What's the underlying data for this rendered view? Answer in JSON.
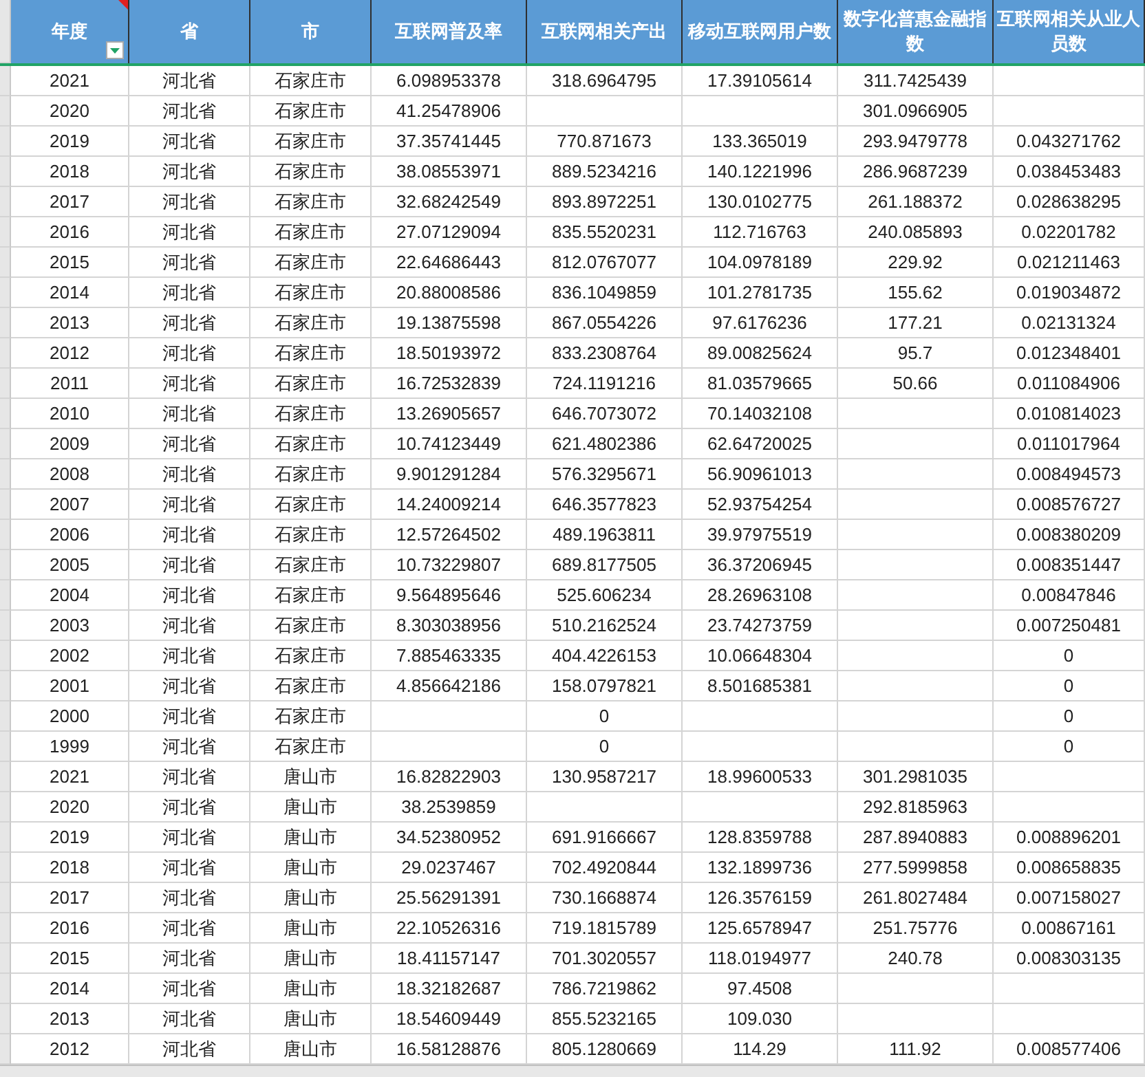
{
  "table": {
    "columns": [
      {
        "label": "年度",
        "filter": true,
        "comment": true
      },
      {
        "label": "省",
        "filter": false,
        "comment": false
      },
      {
        "label": "市",
        "filter": false,
        "comment": false
      },
      {
        "label": "互联网普及率",
        "filter": false,
        "comment": false
      },
      {
        "label": "互联网相关产出",
        "filter": false,
        "comment": false
      },
      {
        "label": "移动互联网用户数",
        "filter": false,
        "comment": false
      },
      {
        "label": "数字化普惠金融指数",
        "filter": false,
        "comment": false
      },
      {
        "label": "互联网相关从业人员数",
        "filter": false,
        "comment": false
      }
    ],
    "rows": [
      [
        "2021",
        "河北省",
        "石家庄市",
        "6.098953378",
        "318.6964795",
        "17.39105614",
        "311.7425439",
        null
      ],
      [
        "2020",
        "河北省",
        "石家庄市",
        "41.25478906",
        null,
        null,
        "301.0966905",
        null
      ],
      [
        "2019",
        "河北省",
        "石家庄市",
        "37.35741445",
        "770.871673",
        "133.365019",
        "293.9479778",
        "0.043271762"
      ],
      [
        "2018",
        "河北省",
        "石家庄市",
        "38.08553971",
        "889.5234216",
        "140.1221996",
        "286.9687239",
        "0.038453483"
      ],
      [
        "2017",
        "河北省",
        "石家庄市",
        "32.68242549",
        "893.8972251",
        "130.0102775",
        "261.188372",
        "0.028638295"
      ],
      [
        "2016",
        "河北省",
        "石家庄市",
        "27.07129094",
        "835.5520231",
        "112.716763",
        "240.085893",
        "0.02201782"
      ],
      [
        "2015",
        "河北省",
        "石家庄市",
        "22.64686443",
        "812.0767077",
        "104.0978189",
        "229.92",
        "0.021211463"
      ],
      [
        "2014",
        "河北省",
        "石家庄市",
        "20.88008586",
        "836.1049859",
        "101.2781735",
        "155.62",
        "0.019034872"
      ],
      [
        "2013",
        "河北省",
        "石家庄市",
        "19.13875598",
        "867.0554226",
        "97.6176236",
        "177.21",
        "0.02131324"
      ],
      [
        "2012",
        "河北省",
        "石家庄市",
        "18.50193972",
        "833.2308764",
        "89.00825624",
        "95.7",
        "0.012348401"
      ],
      [
        "2011",
        "河北省",
        "石家庄市",
        "16.72532839",
        "724.1191216",
        "81.03579665",
        "50.66",
        "0.011084906"
      ],
      [
        "2010",
        "河北省",
        "石家庄市",
        "13.26905657",
        "646.7073072",
        "70.14032108",
        null,
        "0.010814023"
      ],
      [
        "2009",
        "河北省",
        "石家庄市",
        "10.74123449",
        "621.4802386",
        "62.64720025",
        null,
        "0.011017964"
      ],
      [
        "2008",
        "河北省",
        "石家庄市",
        "9.901291284",
        "576.3295671",
        "56.90961013",
        null,
        "0.008494573"
      ],
      [
        "2007",
        "河北省",
        "石家庄市",
        "14.24009214",
        "646.3577823",
        "52.93754254",
        null,
        "0.008576727"
      ],
      [
        "2006",
        "河北省",
        "石家庄市",
        "12.57264502",
        "489.1963811",
        "39.97975519",
        null,
        "0.008380209"
      ],
      [
        "2005",
        "河北省",
        "石家庄市",
        "10.73229807",
        "689.8177505",
        "36.37206945",
        null,
        "0.008351447"
      ],
      [
        "2004",
        "河北省",
        "石家庄市",
        "9.564895646",
        "525.606234",
        "28.26963108",
        null,
        "0.00847846"
      ],
      [
        "2003",
        "河北省",
        "石家庄市",
        "8.303038956",
        "510.2162524",
        "23.74273759",
        null,
        "0.007250481"
      ],
      [
        "2002",
        "河北省",
        "石家庄市",
        "7.885463335",
        "404.4226153",
        "10.06648304",
        null,
        "0"
      ],
      [
        "2001",
        "河北省",
        "石家庄市",
        "4.856642186",
        "158.0797821",
        "8.501685381",
        null,
        "0"
      ],
      [
        "2000",
        "河北省",
        "石家庄市",
        null,
        "0",
        null,
        null,
        "0"
      ],
      [
        "1999",
        "河北省",
        "石家庄市",
        null,
        "0",
        null,
        null,
        "0"
      ],
      [
        "2021",
        "河北省",
        "唐山市",
        "16.82822903",
        "130.9587217",
        "18.99600533",
        "301.2981035",
        null
      ],
      [
        "2020",
        "河北省",
        "唐山市",
        "38.2539859",
        null,
        null,
        "292.8185963",
        null
      ],
      [
        "2019",
        "河北省",
        "唐山市",
        "34.52380952",
        "691.9166667",
        "128.8359788",
        "287.8940883",
        "0.008896201"
      ],
      [
        "2018",
        "河北省",
        "唐山市",
        "29.0237467",
        "702.4920844",
        "132.1899736",
        "277.5999858",
        "0.008658835"
      ],
      [
        "2017",
        "河北省",
        "唐山市",
        "25.56291391",
        "730.1668874",
        "126.3576159",
        "261.8027484",
        "0.007158027"
      ],
      [
        "2016",
        "河北省",
        "唐山市",
        "22.10526316",
        "719.1815789",
        "125.6578947",
        "251.75776",
        "0.00867161"
      ],
      [
        "2015",
        "河北省",
        "唐山市",
        "18.41157147",
        "701.3020557",
        "118.0194977",
        "240.78",
        "0.008303135"
      ],
      [
        "2014",
        "河北省",
        "唐山市",
        "18.32182687",
        "786.7219862",
        "97.4508",
        null,
        null
      ],
      [
        "2013",
        "河北省",
        "唐山市",
        "18.54609449",
        "855.5232165",
        "109.030",
        null,
        null
      ],
      [
        "2012",
        "河北省",
        "唐山市",
        "16.58128876",
        "805.1280669",
        "114.29",
        "111.92",
        "0.008577406"
      ]
    ]
  }
}
